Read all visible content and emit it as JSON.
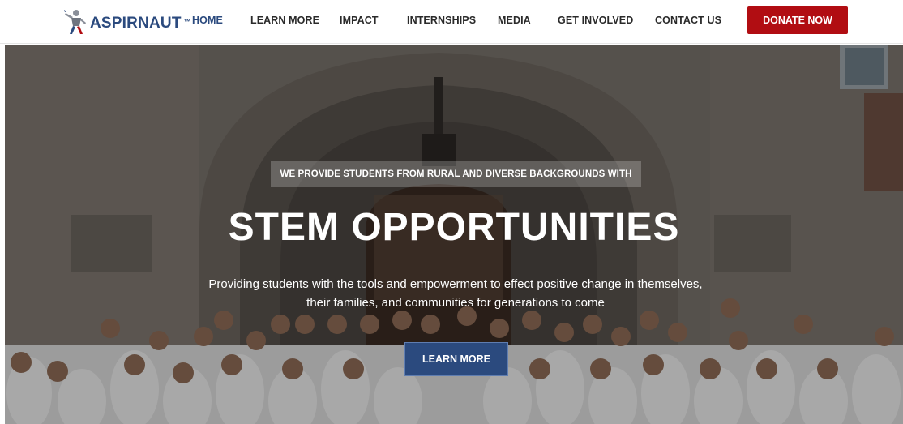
{
  "brand": {
    "name": "ASPIRNAUT",
    "trademark": "™"
  },
  "nav": {
    "items": [
      {
        "label": "HOME",
        "active": true
      },
      {
        "label": "LEARN MORE",
        "active": false
      },
      {
        "label": "IMPACT",
        "active": false
      },
      {
        "label": "INTERNSHIPS",
        "active": false
      },
      {
        "label": "MEDIA",
        "active": false
      },
      {
        "label": "GET INVOLVED",
        "active": false
      },
      {
        "label": "CONTACT US",
        "active": false
      }
    ],
    "donate_label": "DONATE NOW"
  },
  "hero": {
    "eyebrow": "WE PROVIDE STUDENTS FROM RURAL AND DIVERSE BACKGROUNDS WITH",
    "headline": "STEM OPPORTUNITIES",
    "subline": "Providing students with the tools and empowerment to effect positive change in themselves, their families, and communities for generations to come",
    "cta_label": "LEARN MORE"
  },
  "colors": {
    "brand_blue": "#2b4a7e",
    "donate_red": "#b10d12",
    "nav_text": "#2a2a2a"
  },
  "icons": {
    "logo": "astronaut-logo-icon"
  }
}
